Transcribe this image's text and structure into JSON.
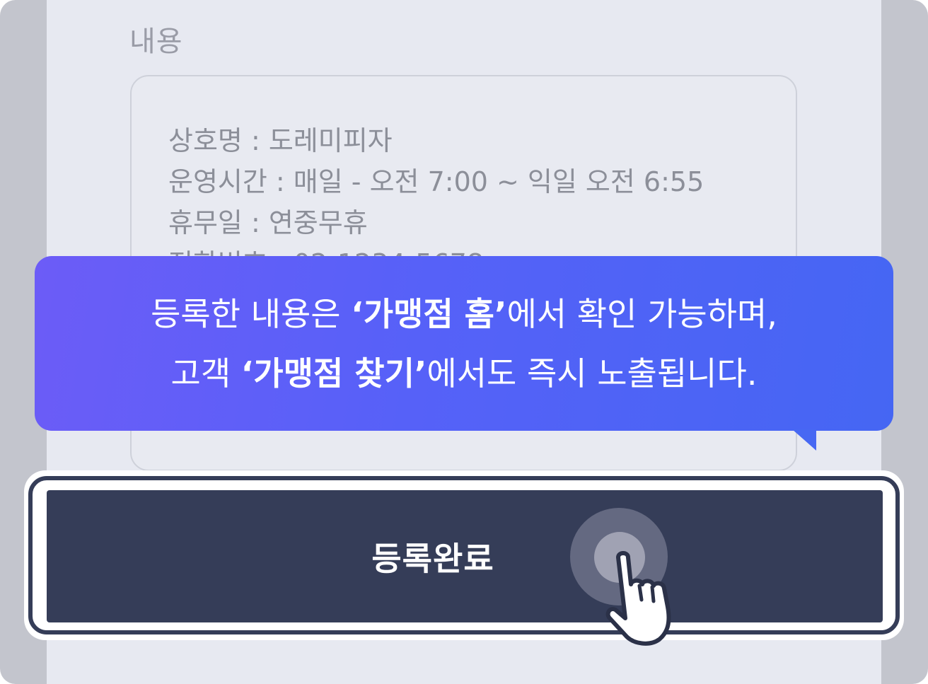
{
  "form": {
    "content_label": "내용",
    "content_lines": [
      "상호명 : 도레미피자",
      "운영시간 : 매일 - 오전 7:00 ~ 익일 오전 6:55",
      "휴무일 : 연중무휴",
      "전화번호 : 02-1234-5678"
    ]
  },
  "tooltip": {
    "line1_prefix": "등록한 내용은 ",
    "line1_bold": "‘가맹점 홈’",
    "line1_suffix": "에서 확인 가능하며,",
    "line2_prefix": "고객 ",
    "line2_bold": "‘가맹점 찾기’",
    "line2_suffix": "에서도 즉시 노출됩니다."
  },
  "button": {
    "label": "등록완료"
  },
  "colors": {
    "button_bg": "#353d58",
    "tooltip_gradient_start": "#6c5cf7",
    "tooltip_gradient_end": "#4566f3"
  },
  "icons": {
    "pointer": "hand-pointer-icon"
  }
}
